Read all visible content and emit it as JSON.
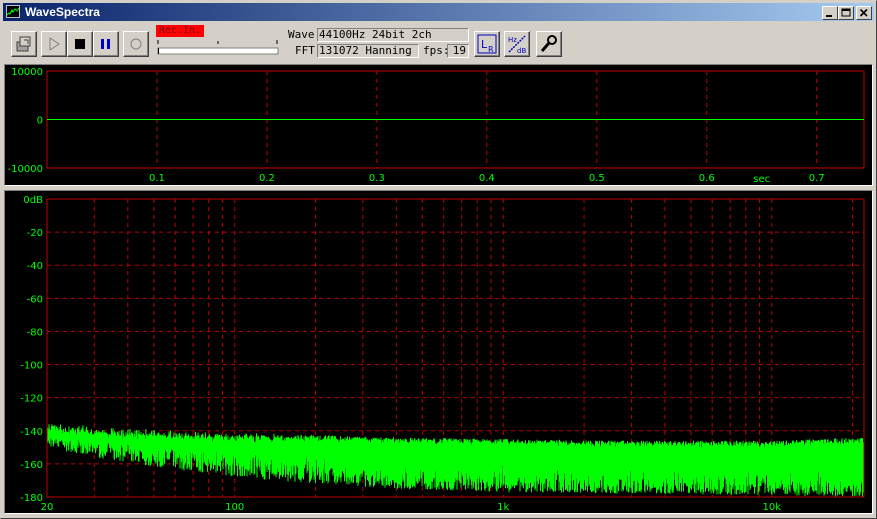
{
  "window": {
    "title": "WaveSpectra"
  },
  "toolbar": {
    "rec_badge": "Rec.In.",
    "wave_label": "Wave:",
    "wave_value": "44100Hz 24bit 2ch",
    "fft_label": "FFT:",
    "fft_value": "131072 Hanning",
    "fps_label": "fps:",
    "fps_value": "19",
    "buttons": [
      "open",
      "play",
      "stop",
      "pause",
      "record",
      "lr-channel",
      "hz-db-scale",
      "settings"
    ]
  },
  "colors": {
    "grid": "#c00000",
    "trace": "#00ff00",
    "label": "#00ff00",
    "border": "#c00000",
    "rec": "#ff0000"
  },
  "chart_data": [
    {
      "type": "line",
      "title": "",
      "xlabel": "sec",
      "ylabel": "",
      "x_ticks": [
        "0.1",
        "0.2",
        "0.3",
        "0.4",
        "0.5",
        "0.6",
        "0.7"
      ],
      "y_ticks": [
        "10000",
        "0",
        "-10000"
      ],
      "xlim": [
        0,
        0.743
      ],
      "ylim": [
        -10000,
        10000
      ],
      "series": [
        {
          "x": [
            0,
            0.743
          ],
          "y": [
            0,
            0
          ]
        }
      ],
      "grid": true
    },
    {
      "type": "line",
      "title": "",
      "xlabel": "",
      "ylabel": "",
      "x_scale": "log",
      "xlim": [
        20,
        22050
      ],
      "ylim": [
        -180,
        0
      ],
      "x_ticks": [
        {
          "v": 20,
          "label": "20"
        },
        {
          "v": 100,
          "label": "100"
        },
        {
          "v": 1000,
          "label": "1k"
        },
        {
          "v": 10000,
          "label": "10k"
        }
      ],
      "y_ticks": [
        "0dB",
        "-20",
        "-40",
        "-60",
        "-80",
        "-100",
        "-120",
        "-140",
        "-160",
        "-180"
      ],
      "grid": true,
      "noise_floor": {
        "freq": [
          20,
          30,
          50,
          100,
          200,
          400,
          1000,
          3000,
          10000,
          22050
        ],
        "top_db": [
          -138,
          -141,
          -143,
          -145,
          -146,
          -148,
          -149,
          -150,
          -150,
          -148
        ],
        "bottom_db": [
          -150,
          -156,
          -162,
          -168,
          -172,
          -175,
          -177,
          -178,
          -179,
          -180
        ]
      }
    }
  ]
}
